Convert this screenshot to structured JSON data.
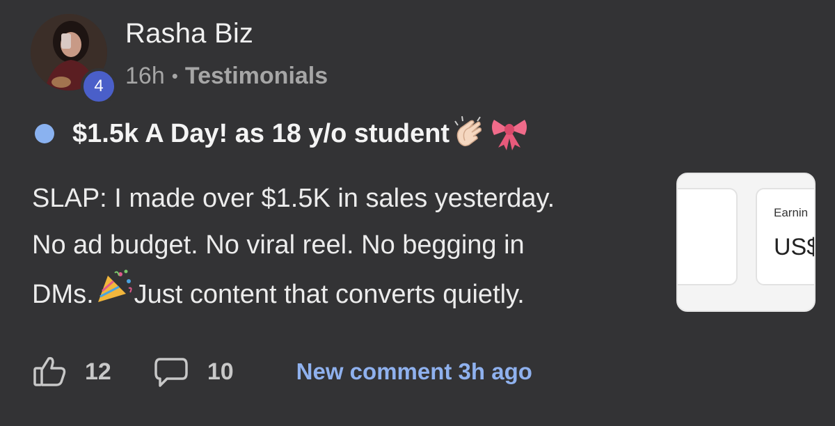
{
  "author": {
    "name": "Rasha Biz",
    "level": "4"
  },
  "meta": {
    "time": "16h",
    "separator": "•",
    "category": "Testimonials"
  },
  "post": {
    "title": "$1.5k A Day! as 18 y/o student",
    "title_emojis": [
      "clapping-hands-emoji",
      "ribbon-emoji"
    ],
    "body_line1": "SLAP: I made over $1.5K in sales yesterday.",
    "body_line2": "No ad budget. No viral reel. No begging in",
    "body_line3_a": "DMs.",
    "body_line3_b": " Just content that converts quietly.",
    "body_emoji": "party-popper-emoji"
  },
  "thumbnail": {
    "label": "Earnin",
    "value": "US$"
  },
  "actions": {
    "likes": "12",
    "comments": "10",
    "new_comment": "New comment 3h ago"
  },
  "colors": {
    "background": "#333335",
    "unread_dot": "#8ab2f0",
    "level_badge": "#4a5fc9",
    "link": "#8fb1ee"
  }
}
